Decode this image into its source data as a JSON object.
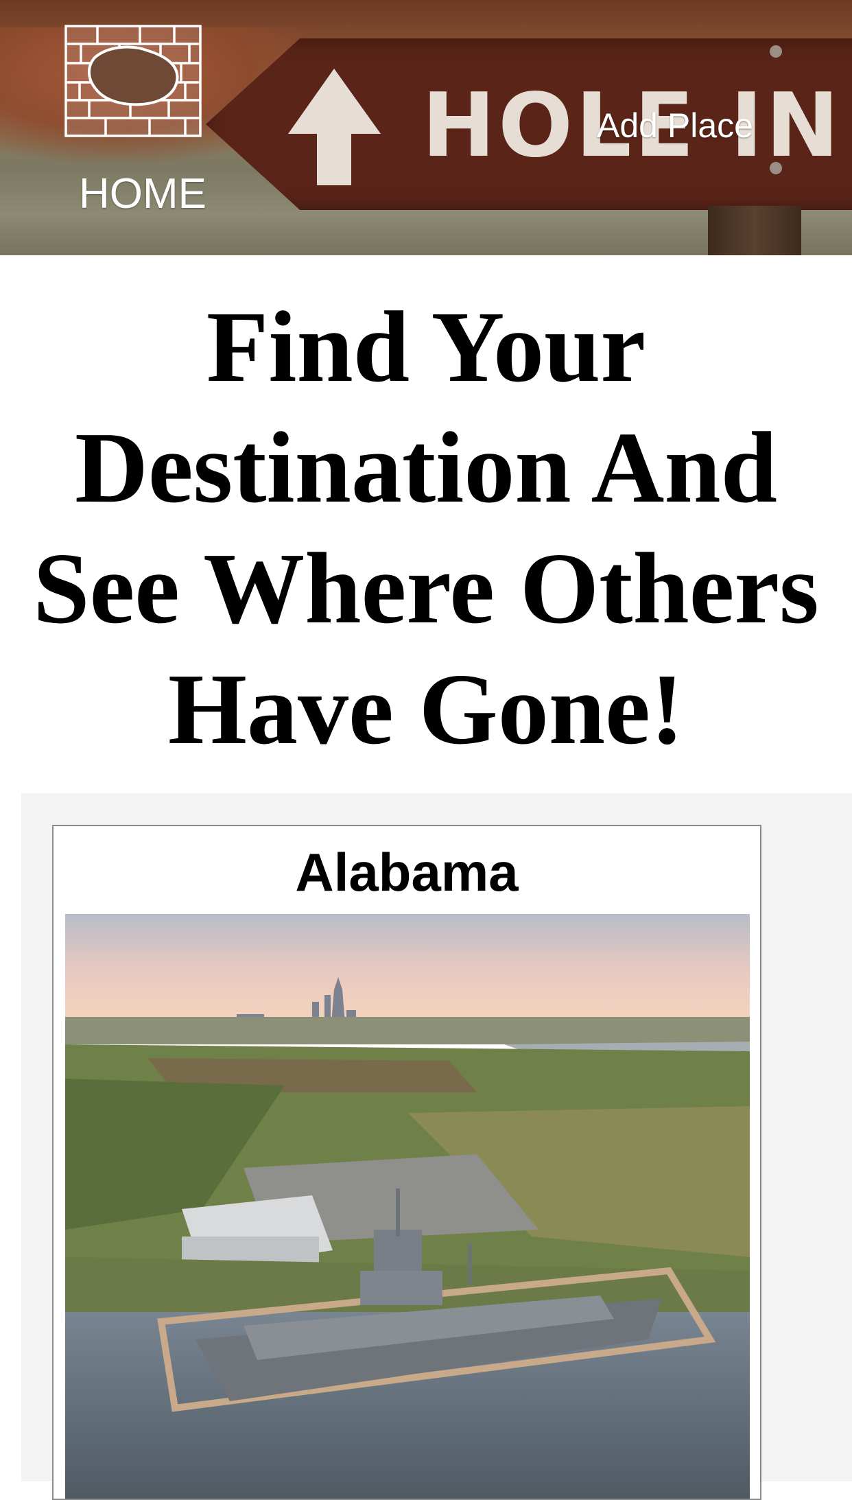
{
  "header": {
    "home_label": "HOME",
    "add_place_label": "Add Place",
    "banner_sign_text": "HOLE IN TH",
    "logo_icon": "stone-wall-hole-icon"
  },
  "headline": "Find Your Destination And See Where Others Have Gone!",
  "cards": [
    {
      "title": "Alabama",
      "image": "aerial view of battleship memorial park and city skyline"
    }
  ],
  "colors": {
    "headline": "#000000",
    "nav_text": "#ffffff",
    "card_area_bg": "#f3f3f3",
    "card_border": "#8a8a8a"
  }
}
